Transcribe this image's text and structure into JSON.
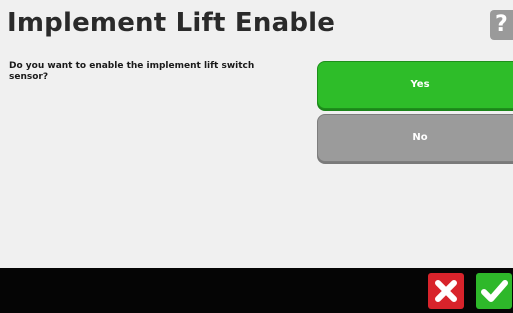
{
  "dialog": {
    "title": "Implement Lift Enable",
    "help_label": "?",
    "question": "Do you want to enable the implement lift switch sensor?"
  },
  "options": {
    "yes_label": "Yes",
    "no_label": "No"
  },
  "footer": {
    "cancel_icon": "close-icon",
    "confirm_icon": "check-icon"
  },
  "colors": {
    "yes_button": "#2ebd29",
    "no_button": "#9b9b9b",
    "cancel_button": "#d8232b",
    "confirm_button": "#2eb82a",
    "footer_bar": "#050505"
  }
}
